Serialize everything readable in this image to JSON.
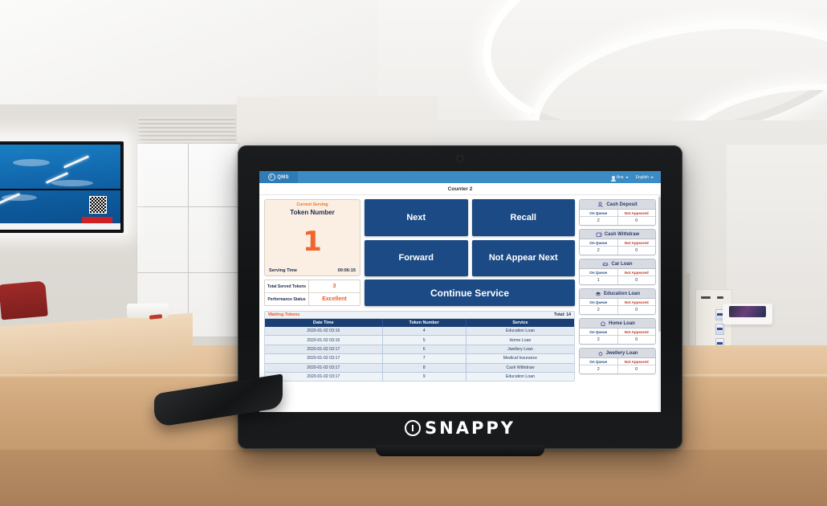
{
  "device": {
    "brand_text": "SNAPPY",
    "brand_logo": "circle-mark-logo"
  },
  "navbar": {
    "logo_text": "QMS",
    "user_label": "Ana",
    "language_label": "English"
  },
  "header": {
    "counter_title": "Counter 2"
  },
  "serving": {
    "label": "Current Serving",
    "token_label": "Token Number",
    "token_number": "1",
    "serving_time_label": "Serving Time",
    "serving_time_value": "00:06:15"
  },
  "stats": [
    {
      "label": "Total Served Tokens",
      "value": "3"
    },
    {
      "label": "Performance Status",
      "value": "Excellent"
    }
  ],
  "actions": {
    "next": "Next",
    "recall": "Recall",
    "forward": "Forward",
    "not_appear_next": "Not Appear Next",
    "continue_service": "Continue Service"
  },
  "waiting_tokens": {
    "title": "Waiting Tokens",
    "total_label": "Total: 14",
    "columns": [
      "Date Time",
      "Token Number",
      "Service"
    ],
    "rows": [
      {
        "datetime": "2020-01-02 03:16",
        "token": "4",
        "service": "Education Loan"
      },
      {
        "datetime": "2020-01-02 03:16",
        "token": "5",
        "service": "Home Loan"
      },
      {
        "datetime": "2020-01-02 03:17",
        "token": "6",
        "service": "Jwellery Loan"
      },
      {
        "datetime": "2020-01-02 03:17",
        "token": "7",
        "service": "Medical Insurance"
      },
      {
        "datetime": "2020-01-02 03:17",
        "token": "8",
        "service": "Cash Withdraw"
      },
      {
        "datetime": "2020-01-02 03:17",
        "token": "9",
        "service": "Education Loan"
      }
    ]
  },
  "services": {
    "col_on_queue": "On Queue",
    "col_not_appeared": "Not Appeared",
    "items": [
      {
        "name": "Cash Deposit",
        "icon": "money-hand-icon",
        "on_queue": "2",
        "not_appeared": "0"
      },
      {
        "name": "Cash Withdraw",
        "icon": "wallet-icon",
        "on_queue": "2",
        "not_appeared": "0"
      },
      {
        "name": "Car Loan",
        "icon": "car-icon",
        "on_queue": "1",
        "not_appeared": "0"
      },
      {
        "name": "Education Loan",
        "icon": "graduation-cap-icon",
        "on_queue": "2",
        "not_appeared": "0"
      },
      {
        "name": "Home Loan",
        "icon": "house-icon",
        "on_queue": "2",
        "not_appeared": "0"
      },
      {
        "name": "Jwellery Loan",
        "icon": "ring-icon",
        "on_queue": "2",
        "not_appeared": "0"
      }
    ]
  },
  "colors": {
    "navbar_blue": "#3d8bc4",
    "button_blue": "#1b4a84",
    "accent_orange": "#f0652f",
    "table_header_navy": "#1b3e73",
    "serving_panel_bg": "#fbeee3",
    "service_header_gray": "#d8dce2"
  }
}
